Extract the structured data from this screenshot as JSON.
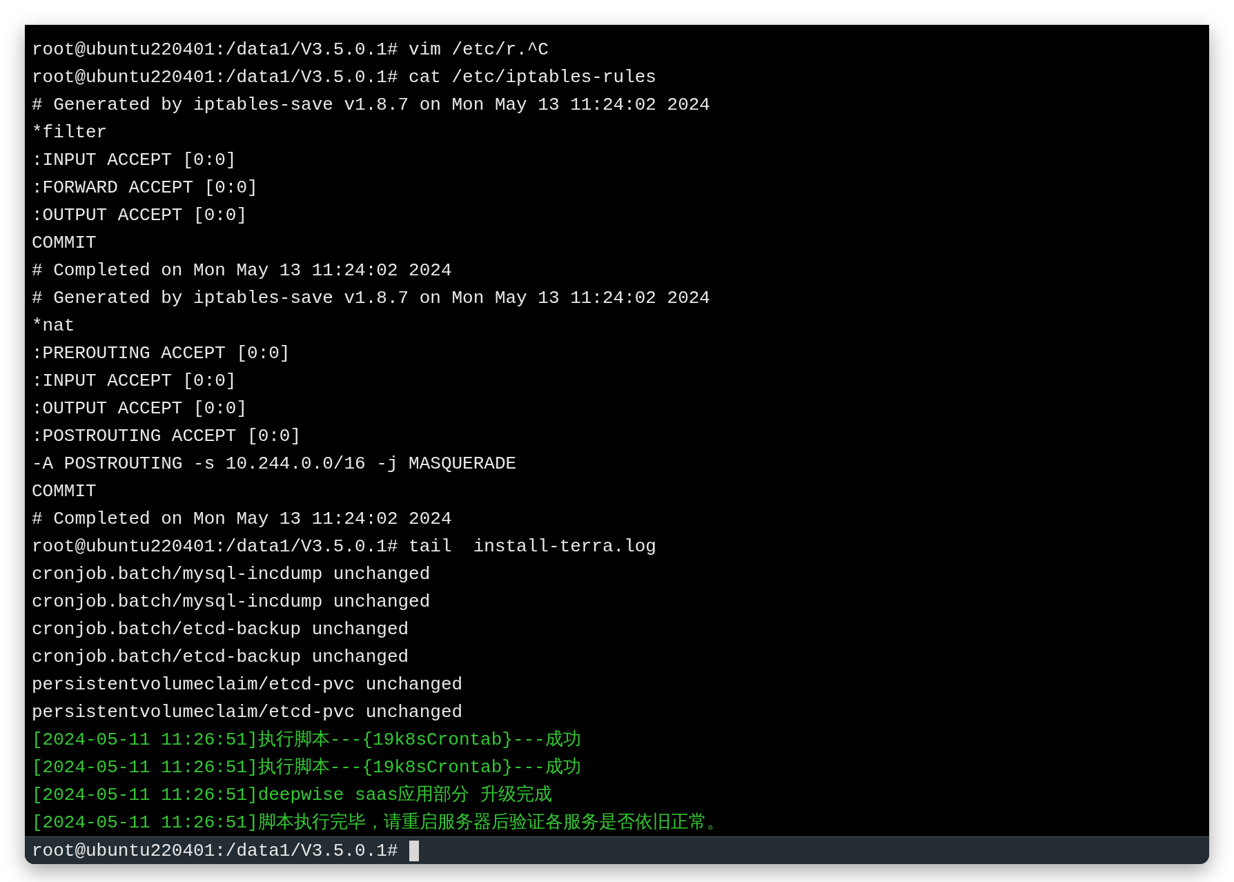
{
  "terminal": {
    "lines": [
      {
        "kind": "plain",
        "text": "root@ubuntu220401:/data1/V3.5.0.1# vim /etc/r.^C"
      },
      {
        "kind": "plain",
        "text": "root@ubuntu220401:/data1/V3.5.0.1# cat /etc/iptables-rules"
      },
      {
        "kind": "plain",
        "text": "# Generated by iptables-save v1.8.7 on Mon May 13 11:24:02 2024"
      },
      {
        "kind": "plain",
        "text": "*filter"
      },
      {
        "kind": "plain",
        "text": ":INPUT ACCEPT [0:0]"
      },
      {
        "kind": "plain",
        "text": ":FORWARD ACCEPT [0:0]"
      },
      {
        "kind": "plain",
        "text": ":OUTPUT ACCEPT [0:0]"
      },
      {
        "kind": "plain",
        "text": "COMMIT"
      },
      {
        "kind": "plain",
        "text": "# Completed on Mon May 13 11:24:02 2024"
      },
      {
        "kind": "plain",
        "text": "# Generated by iptables-save v1.8.7 on Mon May 13 11:24:02 2024"
      },
      {
        "kind": "plain",
        "text": "*nat"
      },
      {
        "kind": "plain",
        "text": ":PREROUTING ACCEPT [0:0]"
      },
      {
        "kind": "plain",
        "text": ":INPUT ACCEPT [0:0]"
      },
      {
        "kind": "plain",
        "text": ":OUTPUT ACCEPT [0:0]"
      },
      {
        "kind": "plain",
        "text": ":POSTROUTING ACCEPT [0:0]"
      },
      {
        "kind": "plain",
        "text": "-A POSTROUTING -s 10.244.0.0/16 -j MASQUERADE"
      },
      {
        "kind": "plain",
        "text": "COMMIT"
      },
      {
        "kind": "plain",
        "text": "# Completed on Mon May 13 11:24:02 2024"
      },
      {
        "kind": "plain",
        "text": "root@ubuntu220401:/data1/V3.5.0.1# tail  install-terra.log"
      },
      {
        "kind": "plain",
        "text": "cronjob.batch/mysql-incdump unchanged"
      },
      {
        "kind": "plain",
        "text": "cronjob.batch/mysql-incdump unchanged"
      },
      {
        "kind": "plain",
        "text": "cronjob.batch/etcd-backup unchanged"
      },
      {
        "kind": "plain",
        "text": "cronjob.batch/etcd-backup unchanged"
      },
      {
        "kind": "plain",
        "text": "persistentvolumeclaim/etcd-pvc unchanged"
      },
      {
        "kind": "plain",
        "text": "persistentvolumeclaim/etcd-pvc unchanged"
      },
      {
        "kind": "success",
        "text": "[2024-05-11 11:26:51]执行脚本---{19k8sCrontab}---成功"
      },
      {
        "kind": "success",
        "text": "[2024-05-11 11:26:51]执行脚本---{19k8sCrontab}---成功"
      },
      {
        "kind": "success",
        "text": "[2024-05-11 11:26:51]deepwise saas应用部分 升级完成"
      },
      {
        "kind": "success",
        "text": "[2024-05-11 11:26:51]脚本执行完毕，请重启服务器后验证各服务是否依旧正常。"
      }
    ],
    "prompt": "root@ubuntu220401:/data1/V3.5.0.1#"
  }
}
